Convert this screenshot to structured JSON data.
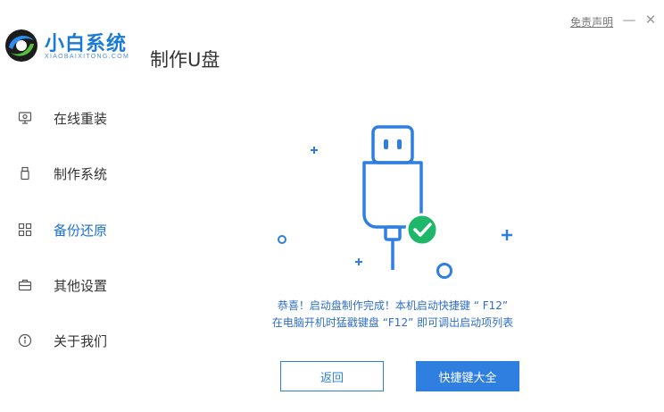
{
  "brand": {
    "name": "小白系统",
    "subtitle": "XIAOBAIXITONG.COM"
  },
  "page_title": "制作U盘",
  "top_bar": {
    "disclaimer": "免责声明",
    "minimize": "—",
    "close": "✕"
  },
  "sidebar": {
    "items": [
      {
        "label": "在线重装",
        "icon": "monitor-icon",
        "active": false
      },
      {
        "label": "制作系统",
        "icon": "usb-icon",
        "active": false
      },
      {
        "label": "备份还原",
        "icon": "grid-icon",
        "active": true
      },
      {
        "label": "其他设置",
        "icon": "briefcase-icon",
        "active": false
      },
      {
        "label": "关于我们",
        "icon": "info-icon",
        "active": false
      }
    ]
  },
  "message": {
    "line1": "恭喜！启动盘制作完成！本机启动快捷键 “ F12”",
    "line2": "在电脑开机时猛戳键盘 “F12” 即可调出启动项列表"
  },
  "buttons": {
    "back": "返回",
    "hotkeys": "快捷键大全"
  },
  "colors": {
    "accent": "#2f7fe0",
    "success": "#1fb86a",
    "text": "#333333"
  }
}
